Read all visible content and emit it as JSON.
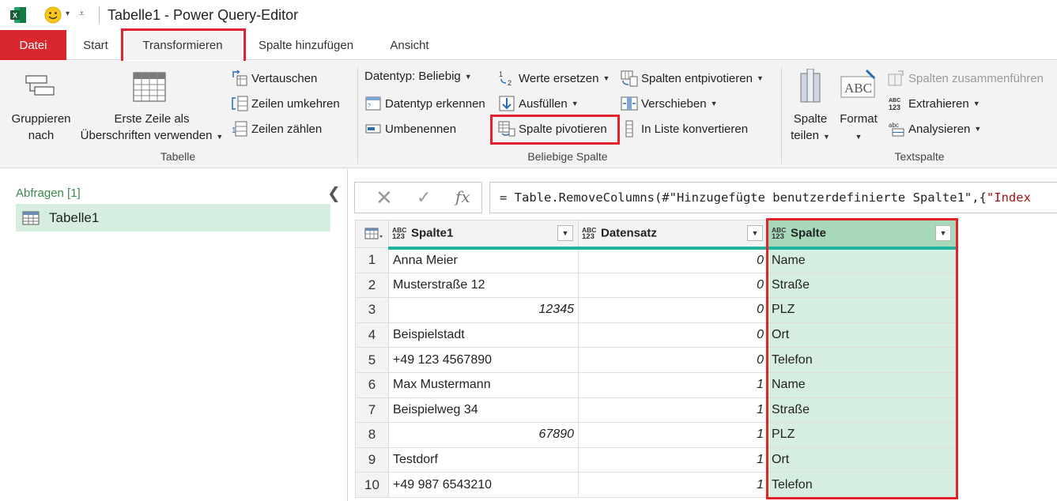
{
  "titlebar": {
    "title": "Tabelle1 - Power Query-Editor"
  },
  "tabs": {
    "file": "Datei",
    "start": "Start",
    "transform": "Transformieren",
    "add_column": "Spalte hinzufügen",
    "view": "Ansicht"
  },
  "ribbon": {
    "table_group": {
      "label": "Tabelle",
      "group_by": [
        "Gruppieren",
        "nach"
      ],
      "first_row": [
        "Erste Zeile als",
        "Überschriften verwenden"
      ],
      "transpose": "Vertauschen",
      "reverse_rows": "Zeilen umkehren",
      "count_rows": "Zeilen zählen"
    },
    "any_column_group": {
      "label": "Beliebige Spalte",
      "data_type": "Datentyp: Beliebig",
      "detect_type": "Datentyp erkennen",
      "rename": "Umbenennen",
      "replace_values": "Werte ersetzen",
      "fill": "Ausfüllen",
      "pivot": "Spalte pivotieren",
      "unpivot": "Spalten entpivotieren",
      "move": "Verschieben",
      "to_list": "In Liste konvertieren"
    },
    "text_column_group": {
      "label": "Textspalte",
      "split": [
        "Spalte",
        "teilen"
      ],
      "format": "Format",
      "merge": "Spalten zusammenführen",
      "extract": "Extrahieren",
      "parse": "Analysieren"
    }
  },
  "queries": {
    "title": "Abfragen [1]",
    "items": [
      "Tabelle1"
    ]
  },
  "formula": {
    "prefix": "= Table.RemoveColumns(#\"Hinzugefügte benutzerdefinierte Spalte1\",{",
    "string_tail": "\"Index"
  },
  "grid": {
    "type_badge": [
      "ABC",
      "123"
    ],
    "columns": [
      "Spalte1",
      "Datensatz",
      "Spalte"
    ],
    "rows": [
      {
        "n": "1",
        "spalte1": "Anna Meier",
        "datensatz": "0",
        "spalte": "Name"
      },
      {
        "n": "2",
        "spalte1": "Musterstraße 12",
        "datensatz": "0",
        "spalte": "Straße"
      },
      {
        "n": "3",
        "spalte1": "12345",
        "datensatz": "0",
        "spalte": "PLZ"
      },
      {
        "n": "4",
        "spalte1": "Beispielstadt",
        "datensatz": "0",
        "spalte": "Ort"
      },
      {
        "n": "5",
        "spalte1": "+49 123 4567890",
        "datensatz": "0",
        "spalte": "Telefon"
      },
      {
        "n": "6",
        "spalte1": "Max Mustermann",
        "datensatz": "1",
        "spalte": "Name"
      },
      {
        "n": "7",
        "spalte1": "Beispielweg 34",
        "datensatz": "1",
        "spalte": "Straße"
      },
      {
        "n": "8",
        "spalte1": "67890",
        "datensatz": "1",
        "spalte": "PLZ"
      },
      {
        "n": "9",
        "spalte1": "Testdorf",
        "datensatz": "1",
        "spalte": "Ort"
      },
      {
        "n": "10",
        "spalte1": "+49 987 6543210",
        "datensatz": "1",
        "spalte": "Telefon"
      }
    ]
  },
  "colors": {
    "file_tab": "#d9272e",
    "highlight_box": "#e2232b",
    "selected_column": "#d5eee0",
    "selected_header": "#a6d8b9",
    "column_bar": "#1fb3a0",
    "queries_title": "#3c8a4c"
  },
  "icons": [
    "excel-icon",
    "smiley-icon",
    "group-by-icon",
    "first-row-icon",
    "transpose-icon",
    "reverse-rows-icon",
    "count-rows-icon",
    "detect-type-icon",
    "rename-icon",
    "replace-values-icon",
    "fill-icon",
    "pivot-icon",
    "unpivot-icon",
    "move-icon",
    "to-list-icon",
    "split-column-icon",
    "format-icon",
    "merge-columns-icon",
    "extract-icon",
    "parse-icon",
    "table-icon",
    "cancel-icon",
    "confirm-icon",
    "fx-icon"
  ]
}
